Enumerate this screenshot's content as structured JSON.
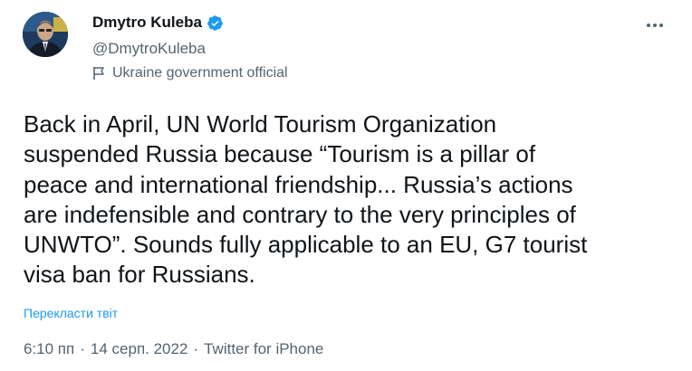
{
  "author": {
    "display_name": "Dmytro Kuleba",
    "handle": "@DmytroKuleba",
    "label": "Ukraine government official",
    "verified": true
  },
  "tweet": {
    "text": "Back in April, UN World Tourism Organization\nsuspended Russia because “Tourism is a pillar of\npeace and international friendship... Russia’s actions\nare indefensible and contrary to the very principles of\nUNWTO”. Sounds fully applicable to an EU, G7 tourist\nvisa ban for Russians.",
    "translate_label": "Перекласти твіт"
  },
  "meta": {
    "time": "6:10 пп",
    "separator": "·",
    "date": "14 серп. 2022",
    "source": "Twitter for iPhone"
  },
  "colors": {
    "text_primary": "#0f1419",
    "text_secondary": "#536471",
    "accent": "#1d9bf0"
  },
  "icons": {
    "verified": "verified-badge-icon",
    "label": "flag-icon",
    "more": "more-options-icon"
  }
}
